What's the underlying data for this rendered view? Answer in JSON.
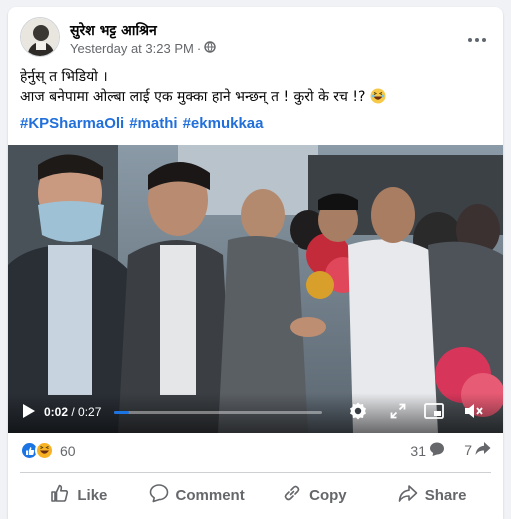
{
  "post": {
    "author": "सुरेश भट्ट आश्रिन",
    "timestamp": "Yesterday at 3:23 PM",
    "separator": "·",
    "text_line1": "हेर्नुस् त भिडियो ।",
    "text_line2": "आज बनेपामा ओल्बा लाई एक मुक्का हाने भन्छन् त ! कुरो के रच !?",
    "hashtags": [
      "#KPSharmaOli",
      "#mathi",
      "#ekmukkaa"
    ]
  },
  "video": {
    "current_time": "0:02",
    "duration": "/ 0:27",
    "progress": 0.074
  },
  "stats": {
    "reaction_count": "60",
    "comment_count": "31",
    "share_count": "7"
  },
  "actions": {
    "like": "Like",
    "comment": "Comment",
    "copy": "Copy",
    "share": "Share"
  },
  "colors": {
    "hashtag": "#216fdb",
    "like_reaction": "#1b74e4",
    "haha_reaction": "#f7b125",
    "progress": "#1b74e4"
  },
  "icons": [
    "globe-icon",
    "more-icon",
    "play-icon",
    "settings-icon",
    "fullscreen-icon",
    "pip-icon",
    "volume-icon",
    "like-reaction-icon",
    "haha-reaction-icon",
    "comment-icon",
    "share-icon",
    "like-icon",
    "copy-icon"
  ]
}
